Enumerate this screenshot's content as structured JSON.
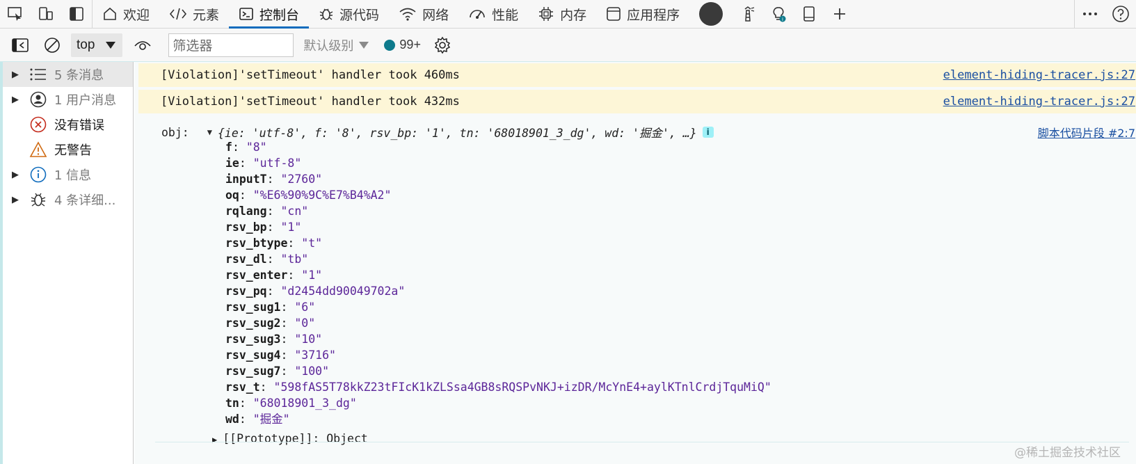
{
  "tabbar": {
    "tabs": [
      {
        "label": "欢迎",
        "icon": "home-icon"
      },
      {
        "label": "元素",
        "icon": "code-icon"
      },
      {
        "label": "控制台",
        "icon": "console-icon",
        "active": true
      },
      {
        "label": "源代码",
        "icon": "bug-icon"
      },
      {
        "label": "网络",
        "icon": "wifi-icon"
      },
      {
        "label": "性能",
        "icon": "gauge-icon"
      },
      {
        "label": "内存",
        "icon": "chip-icon"
      },
      {
        "label": "应用程序",
        "icon": "app-window-icon"
      }
    ],
    "accent": "#0f6cbd"
  },
  "toolbar": {
    "context": "top",
    "filter_placeholder": "筛选器",
    "level_label": "默认级别",
    "issues_count": "99+"
  },
  "sidebar": {
    "items": [
      {
        "label": "5 条消息",
        "icon": "list-icon",
        "expandable": true,
        "selected": true
      },
      {
        "label": "1 用户消息",
        "icon": "user-icon",
        "expandable": true
      },
      {
        "label": "没有错误",
        "icon": "error-icon",
        "expandable": false
      },
      {
        "label": "无警告",
        "icon": "warning-icon",
        "expandable": false
      },
      {
        "label": "1 信息",
        "icon": "info-icon",
        "expandable": true
      },
      {
        "label": "4 条详细...",
        "icon": "bug-icon",
        "expandable": true
      }
    ]
  },
  "console": {
    "warnings": [
      {
        "message": "[Violation]'setTimeout' handler took 460ms",
        "source": "element-hiding-tracer.js:27"
      },
      {
        "message": "[Violation]'setTimeout' handler took 432ms",
        "source": "element-hiding-tracer.js:27"
      }
    ],
    "object_log": {
      "label": "obj:",
      "preview": "{ie: 'utf-8', f: '8', rsv_bp: '1', tn: '68018901_3_dg', wd: '掘金', …}",
      "source": "脚本代码片段 #2:7",
      "properties": [
        {
          "key": "f",
          "value": "\"8\""
        },
        {
          "key": "ie",
          "value": "\"utf-8\""
        },
        {
          "key": "inputT",
          "value": "\"2760\""
        },
        {
          "key": "oq",
          "value": "\"%E6%90%9C%E7%B4%A2\""
        },
        {
          "key": "rqlang",
          "value": "\"cn\""
        },
        {
          "key": "rsv_bp",
          "value": "\"1\""
        },
        {
          "key": "rsv_btype",
          "value": "\"t\""
        },
        {
          "key": "rsv_dl",
          "value": "\"tb\""
        },
        {
          "key": "rsv_enter",
          "value": "\"1\""
        },
        {
          "key": "rsv_pq",
          "value": "\"d2454dd90049702a\""
        },
        {
          "key": "rsv_sug1",
          "value": "\"6\""
        },
        {
          "key": "rsv_sug2",
          "value": "\"0\""
        },
        {
          "key": "rsv_sug3",
          "value": "\"10\""
        },
        {
          "key": "rsv_sug4",
          "value": "\"3716\""
        },
        {
          "key": "rsv_sug7",
          "value": "\"100\""
        },
        {
          "key": "rsv_t",
          "value": "\"598fAS5T78kkZ23tFIcK1kZLSsa4GB8sRQSPvNKJ+izDR/McYnE4+aylKTnlCrdjTquMiQ\""
        },
        {
          "key": "tn",
          "value": "\"68018901_3_dg\""
        },
        {
          "key": "wd",
          "value": "\"掘金\""
        }
      ],
      "prototype_key": "[[Prototype]]",
      "prototype_value": "Object"
    }
  },
  "watermark": "@稀土掘金技术社区"
}
